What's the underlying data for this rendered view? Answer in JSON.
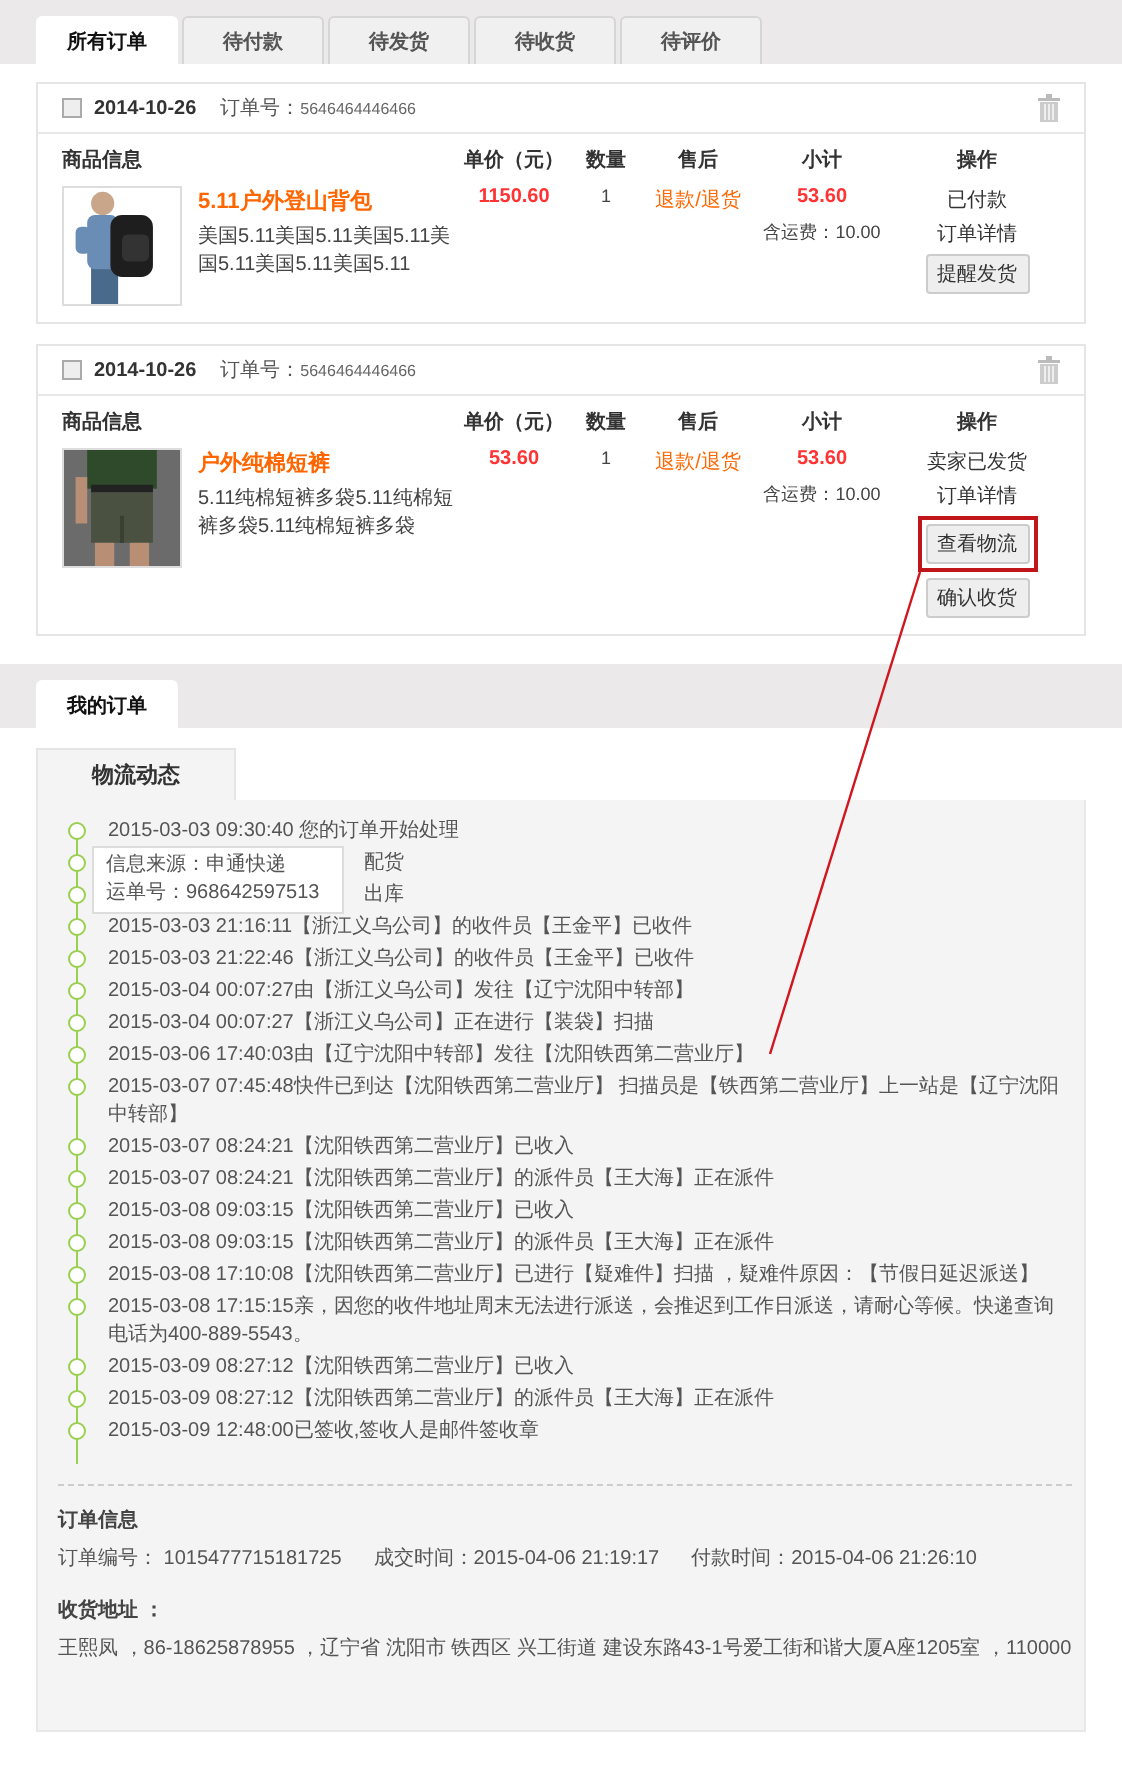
{
  "order_tabs": [
    {
      "label": "所有订单",
      "selected": true
    },
    {
      "label": "待付款",
      "selected": false
    },
    {
      "label": "待发货",
      "selected": false
    },
    {
      "label": "待收货",
      "selected": false
    },
    {
      "label": "待评价",
      "selected": false
    }
  ],
  "orders": [
    {
      "checked": false,
      "date": "2014-10-26",
      "order_no_label": "订单号：",
      "order_no": "5646464446466",
      "headers": [
        "商品信息",
        "单价（元）",
        "数量",
        "售后",
        "小计",
        "操作"
      ],
      "product": {
        "kind": "picture",
        "title": "5.11户外登山背包",
        "desc": "美国5.11美国5.11美国5.11美国5.11美国5.11美国5.11"
      },
      "price": "1150.60",
      "qty": "1",
      "after_sale": "退款/退货",
      "subtotal": "53.60",
      "shipping": "含运费：10.00",
      "status": "已付款",
      "detail_link": "订单详情",
      "buttons": [
        {
          "label": "提醒发货",
          "highlighted": false
        }
      ]
    },
    {
      "checked": false,
      "date": "2014-10-26",
      "order_no_label": "订单号：",
      "order_no": "5646464446466",
      "headers": [
        "商品信息",
        "单价（元）",
        "数量",
        "售后",
        "小计",
        "操作"
      ],
      "product": {
        "kind": "picture",
        "title": "户外纯棉短裤",
        "desc": "5.11纯棉短裤多袋5.11纯棉短裤多袋5.11纯棉短裤多袋"
      },
      "price": "53.60",
      "qty": "1",
      "after_sale": "退款/退货",
      "subtotal": "53.60",
      "shipping": "含运费：10.00",
      "status": "卖家已发货",
      "detail_link": "订单详情",
      "buttons": [
        {
          "label": "查看物流",
          "highlighted": true
        },
        {
          "label": "确认收货",
          "highlighted": false
        }
      ]
    }
  ],
  "page_tab": {
    "label": "我的订单",
    "selected": true
  },
  "logistics": {
    "tab": "物流动态",
    "tooltip": {
      "source": "信息来源：申通快递",
      "waybill": "运单号：968642597513"
    },
    "events": [
      {
        "text": "2015-03-03 09:30:40  您的订单开始处理",
        "kind": "full"
      },
      {
        "text": "配货",
        "kind": "partial"
      },
      {
        "text": "出库",
        "kind": "partial"
      },
      {
        "text": "2015-03-03 21:16:11【浙江义乌公司】的收件员【王金平】已收件",
        "kind": "full"
      },
      {
        "text": "2015-03-03 21:22:46【浙江义乌公司】的收件员【王金平】已收件",
        "kind": "full"
      },
      {
        "text": "2015-03-04 00:07:27由【浙江义乌公司】发往【辽宁沈阳中转部】",
        "kind": "full"
      },
      {
        "text": "2015-03-04 00:07:27【浙江义乌公司】正在进行【装袋】扫描",
        "kind": "full"
      },
      {
        "text": "2015-03-06 17:40:03由【辽宁沈阳中转部】发往【沈阳铁西第二营业厅】",
        "kind": "full"
      },
      {
        "text": "2015-03-07 07:45:48快件已到达【沈阳铁西第二营业厅】 扫描员是【铁西第二营业厅】上一站是【辽宁沈阳中转部】",
        "kind": "full"
      },
      {
        "text": "2015-03-07 08:24:21【沈阳铁西第二营业厅】已收入",
        "kind": "full"
      },
      {
        "text": "2015-03-07 08:24:21【沈阳铁西第二营业厅】的派件员【王大海】正在派件",
        "kind": "full"
      },
      {
        "text": "2015-03-08 09:03:15【沈阳铁西第二营业厅】已收入",
        "kind": "full"
      },
      {
        "text": "2015-03-08 09:03:15【沈阳铁西第二营业厅】的派件员【王大海】正在派件",
        "kind": "full"
      },
      {
        "text": "2015-03-08 17:10:08【沈阳铁西第二营业厅】已进行【疑难件】扫描 ，疑难件原因：【节假日延迟派送】",
        "kind": "full"
      },
      {
        "text": "2015-03-08 17:15:15亲，因您的收件地址周末无法进行派送，会推迟到工作日派送，请耐心等候。快递查询电话为400-889-5543。",
        "kind": "full"
      },
      {
        "text": "2015-03-09 08:27:12【沈阳铁西第二营业厅】已收入",
        "kind": "full"
      },
      {
        "text": "2015-03-09 08:27:12【沈阳铁西第二营业厅】的派件员【王大海】正在派件",
        "kind": "full"
      },
      {
        "text": "2015-03-09 12:48:00已签收,签收人是邮件签收章",
        "kind": "full"
      }
    ],
    "order_info": {
      "title": "订单信息",
      "fields": [
        "订单编号： 1015477715181725",
        "成交时间：2015-04-06 21:19:17",
        "付款时间：2015-04-06 21:26:10"
      ]
    },
    "address": {
      "title": "收货地址 ：",
      "text": "王熙凤 ，86-18625878955 ，辽宁省 沈阳市 铁西区 兴工街道 建设东路43-1号爱工街和谐大厦A座1205室 ，110000"
    }
  }
}
